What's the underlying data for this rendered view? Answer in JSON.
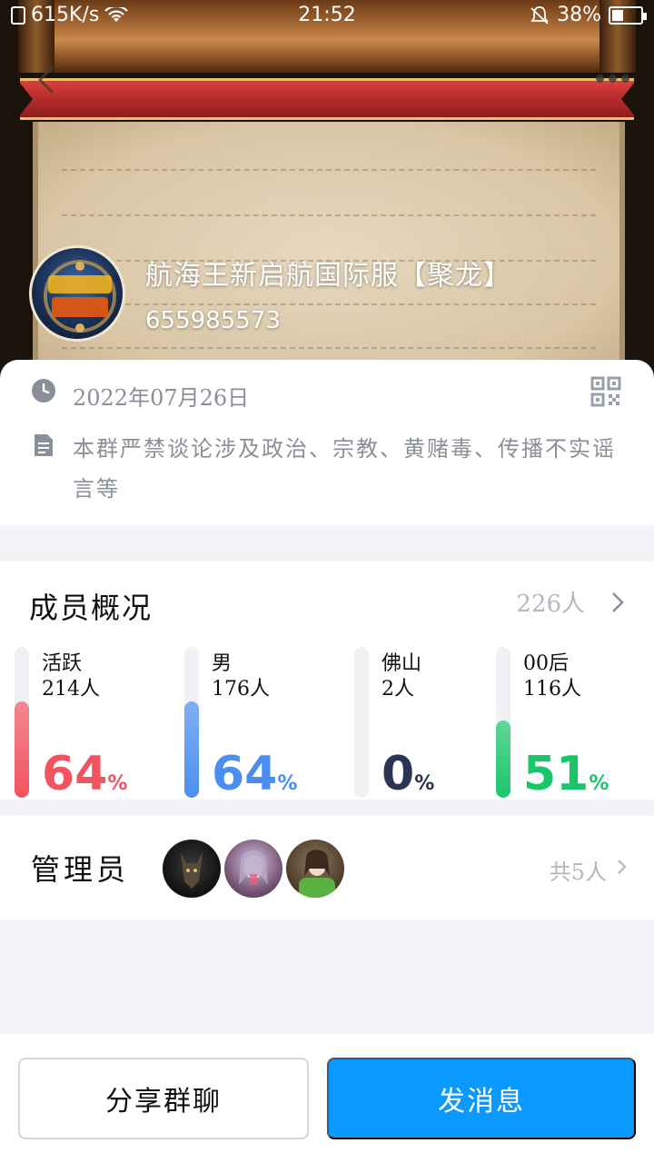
{
  "status_bar": {
    "speed": "615K/s",
    "time": "21:52",
    "battery": "38%"
  },
  "header": {
    "group_name": "航海王新启航国际服【聚龙】",
    "group_id": "655985573"
  },
  "info": {
    "date": "2022年07月26日",
    "description": "本群严禁谈论涉及政治、宗教、黄赌毒、传播不实谣言等"
  },
  "members": {
    "title": "成员概况",
    "count": "226人",
    "stats": [
      {
        "label": "活跃",
        "value": "214人",
        "percent": "64",
        "fill": 0.64,
        "color": "#f2535f"
      },
      {
        "label": "男",
        "value": "176人",
        "percent": "64",
        "fill": 0.64,
        "color": "#4a8ff0"
      },
      {
        "label": "佛山",
        "value": "2人",
        "percent": "0",
        "fill": 0.0,
        "color": "#2b3553"
      },
      {
        "label": "00后",
        "value": "116人",
        "percent": "51",
        "fill": 0.51,
        "color": "#19c76a"
      }
    ],
    "percent_sign": "%"
  },
  "admins": {
    "title": "管理员",
    "total": "共5人"
  },
  "actions": {
    "share_label": "分享群聊",
    "send_label": "发消息"
  }
}
